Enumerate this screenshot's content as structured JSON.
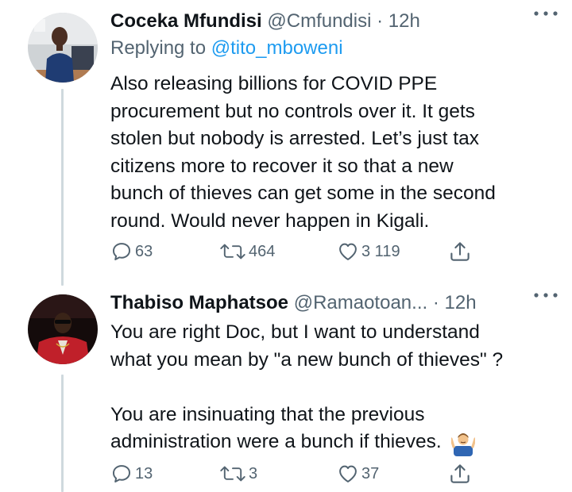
{
  "tweets": [
    {
      "author_name": "Coceka Mfundisi",
      "handle": "@Cmfundisi",
      "separator": "·",
      "time": "12h",
      "replying_prefix": "Replying to",
      "replying_to": "@tito_mboweni",
      "text_lines": [
        "Also releasing billions for COVID PPE",
        "procurement but no controls over it. It gets",
        "stolen but nobody is arrested. Let’s just tax",
        "citizens more to recover it so that a new",
        "bunch of thieves can get some in the second",
        "round. Would never happen in Kigali."
      ],
      "replies": "63",
      "retweets": "464",
      "likes": "3 119"
    },
    {
      "author_name": "Thabiso Maphatsoe",
      "handle": "@Ramaotoan...",
      "separator": "·",
      "time": "12h",
      "paragraph1_lines": [
        "You are right Doc, but I want to understand",
        "what you mean by \"a new bunch of thieves\" ?"
      ],
      "paragraph2_lines": [
        "You are insinuating that the previous",
        "administration were a bunch if thieves."
      ],
      "emoji_name": "man-shrugging-emoji",
      "replies": "13",
      "retweets": "3",
      "likes": "37"
    }
  ],
  "icons": {
    "reply": "reply-icon",
    "retweet": "retweet-icon",
    "like": "heart-icon",
    "share": "share-icon",
    "more": "more-options-icon"
  },
  "colors": {
    "text": "#0f1419",
    "secondary": "#536471",
    "link": "#1d9bf0",
    "thread_line": "#cfd9de"
  }
}
